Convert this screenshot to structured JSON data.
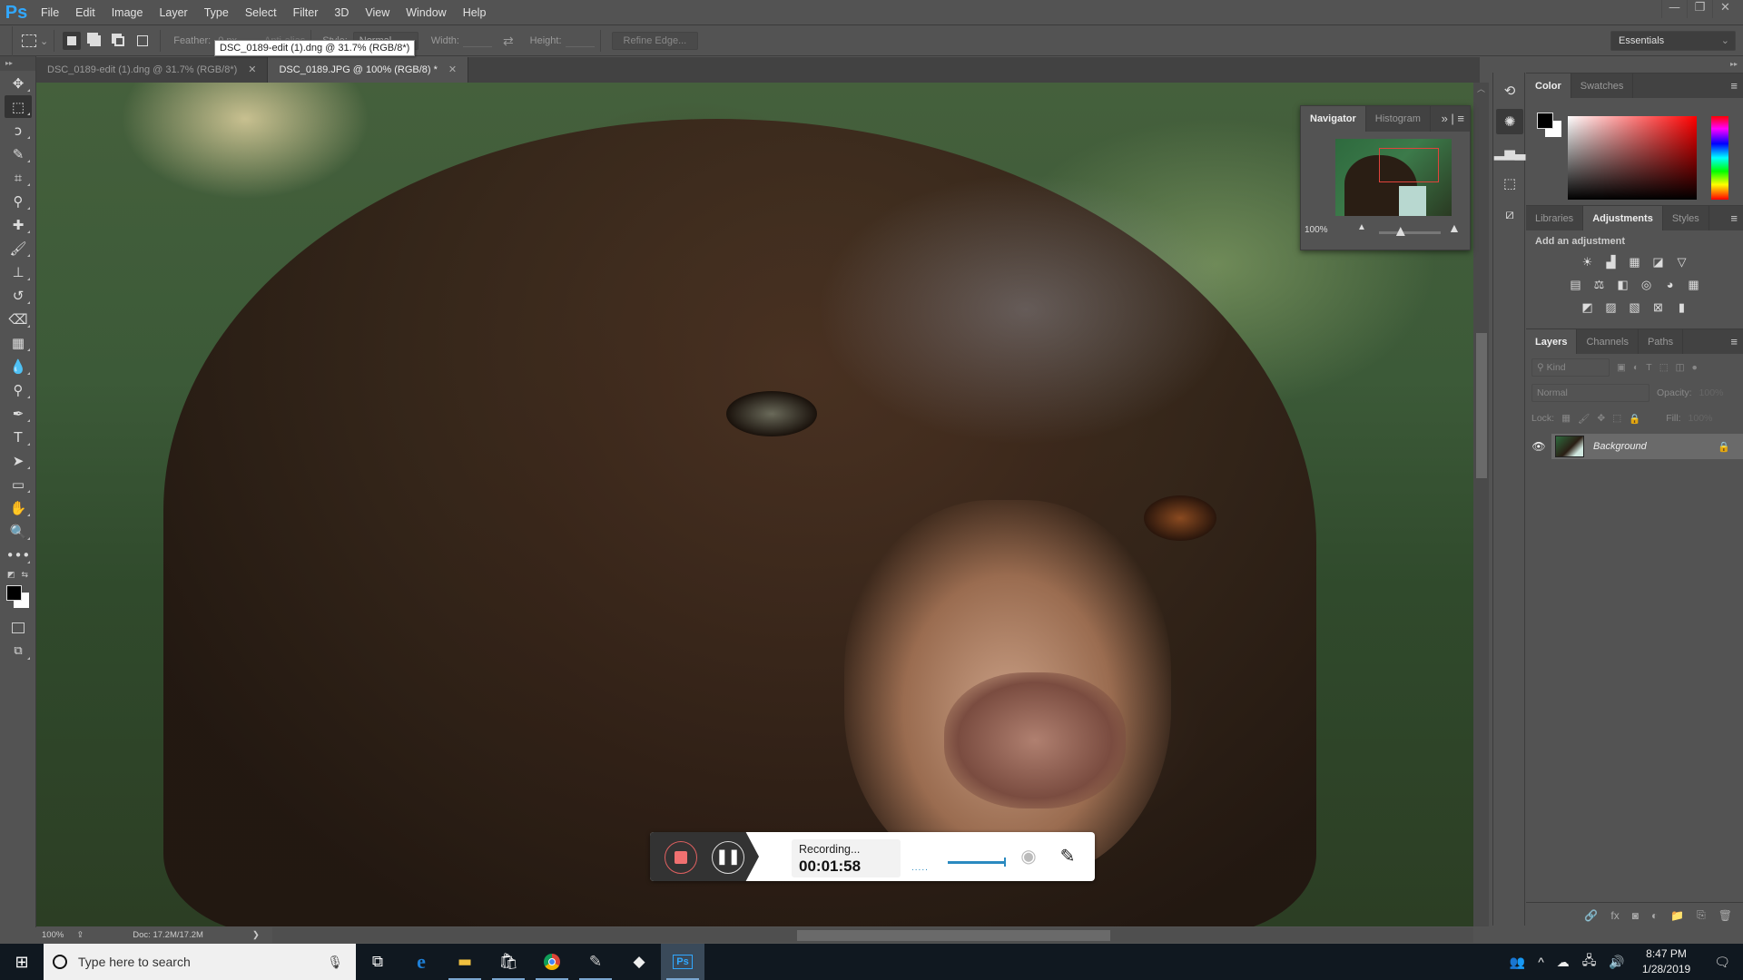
{
  "app": {
    "logo": "Ps",
    "name": "Adobe Photoshop"
  },
  "menu": [
    "File",
    "Edit",
    "Image",
    "Layer",
    "Type",
    "Select",
    "Filter",
    "3D",
    "View",
    "Window",
    "Help"
  ],
  "window_controls": {
    "minimize": "—",
    "restore": "❐",
    "close": "✕"
  },
  "options_bar": {
    "feather_label": "Feather:",
    "feather_value": "0 px",
    "anti_alias_label": "Anti-alias",
    "style_label": "Style:",
    "style_value": "Normal",
    "width_label": "Width:",
    "height_label": "Height:",
    "refine_edge_label": "Refine Edge...",
    "workspace": "Essentials"
  },
  "tooltip": "DSC_0189-edit (1).dng @ 31.7% (RGB/8*)",
  "doc_tabs": [
    {
      "label": "DSC_0189-edit (1).dng @ 31.7% (RGB/8*)",
      "active": false
    },
    {
      "label": "DSC_0189.JPG @ 100% (RGB/8) *",
      "active": true
    }
  ],
  "tools": [
    {
      "name": "move-tool",
      "glyph": "✥"
    },
    {
      "name": "marquee-tool",
      "glyph": "⬚",
      "active": true
    },
    {
      "name": "lasso-tool",
      "glyph": "ↄ"
    },
    {
      "name": "quick-selection-tool",
      "glyph": "✎"
    },
    {
      "name": "crop-tool",
      "glyph": "⌗"
    },
    {
      "name": "eyedropper-tool",
      "glyph": "⚲"
    },
    {
      "name": "healing-brush-tool",
      "glyph": "✚"
    },
    {
      "name": "brush-tool",
      "glyph": "🖌"
    },
    {
      "name": "clone-stamp-tool",
      "glyph": "⊥"
    },
    {
      "name": "history-brush-tool",
      "glyph": "↺"
    },
    {
      "name": "eraser-tool",
      "glyph": "⌫"
    },
    {
      "name": "gradient-tool",
      "glyph": "▦"
    },
    {
      "name": "blur-tool",
      "glyph": "💧"
    },
    {
      "name": "dodge-tool",
      "glyph": "⚲"
    },
    {
      "name": "pen-tool",
      "glyph": "✒"
    },
    {
      "name": "type-tool",
      "glyph": "T"
    },
    {
      "name": "path-selection-tool",
      "glyph": "➤"
    },
    {
      "name": "rectangle-tool",
      "glyph": "▭"
    },
    {
      "name": "hand-tool",
      "glyph": "✋"
    },
    {
      "name": "zoom-tool",
      "glyph": "🔍"
    },
    {
      "name": "more-tools",
      "glyph": "•••"
    }
  ],
  "status_bar": {
    "zoom": "100%",
    "doc": "Doc: 17.2M/17.2M",
    "arrow": "❯"
  },
  "navigator": {
    "tabs": [
      "Navigator",
      "Histogram"
    ],
    "zoom": "100%",
    "zoom_slider_fraction": 0.35
  },
  "color_panel": {
    "tabs": [
      "Color",
      "Swatches"
    ],
    "foreground": "#000000",
    "background": "#ffffff"
  },
  "adjustments_panel": {
    "tabs": [
      "Libraries",
      "Adjustments",
      "Styles"
    ],
    "title": "Add an adjustment",
    "rows": [
      [
        "☀",
        "▟",
        "▦",
        "◪",
        "▽"
      ],
      [
        "▤",
        "⚖",
        "◧",
        "◎",
        "◕",
        "▦"
      ],
      [
        "◩",
        "▨",
        "▧",
        "⊠",
        "▮"
      ]
    ]
  },
  "layers_panel": {
    "tabs": [
      "Layers",
      "Channels",
      "Paths"
    ],
    "filter_label": "Kind",
    "blend_mode": "Normal",
    "opacity_label": "Opacity:",
    "opacity_value": "100%",
    "lock_label": "Lock:",
    "fill_label": "Fill:",
    "fill_value": "100%",
    "layers": [
      {
        "name": "Background",
        "visible": true,
        "locked": true
      }
    ],
    "footer_icons": [
      "🔗",
      "fx",
      "◙",
      "◐",
      "📁",
      "⎘",
      "🗑"
    ]
  },
  "recorder": {
    "status": "Recording...",
    "elapsed": "00:01:58",
    "accent": "#2a8ac0",
    "stop_color": "#f07070"
  },
  "taskbar": {
    "search_placeholder": "Type here to search",
    "apps": [
      "task-view",
      "edge",
      "file-explorer",
      "store",
      "chrome",
      "pen-app",
      "vectr",
      "photoshop"
    ],
    "time": "8:47 PM",
    "date": "1/28/2019"
  }
}
